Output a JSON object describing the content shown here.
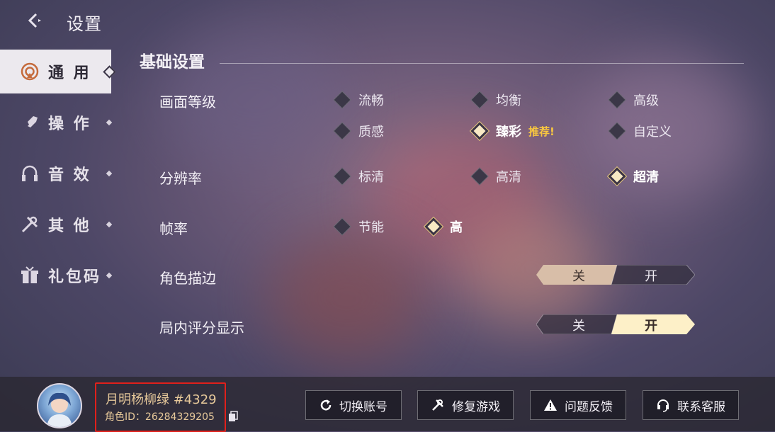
{
  "header": {
    "title": "设置"
  },
  "sidebar": {
    "items": [
      {
        "label": "通 用",
        "icon": "general-icon",
        "active": true
      },
      {
        "label": "操 作",
        "icon": "operation-icon",
        "active": false
      },
      {
        "label": "音 效",
        "icon": "headphones-icon",
        "active": false
      },
      {
        "label": "其 他",
        "icon": "tools-icon",
        "active": false
      },
      {
        "label": "礼包码",
        "icon": "gift-icon",
        "active": false
      }
    ]
  },
  "section": {
    "title": "基础设置"
  },
  "settings": {
    "quality": {
      "label": "画面等级",
      "options": [
        "流畅",
        "均衡",
        "高级",
        "质感",
        "臻彩",
        "自定义"
      ],
      "selected": "臻彩",
      "badge": "推荐!"
    },
    "resolution": {
      "label": "分辨率",
      "options": [
        "标清",
        "高清",
        "超清"
      ],
      "selected": "超清"
    },
    "framerate": {
      "label": "帧率",
      "options": [
        "节能",
        "高"
      ],
      "selected": "高"
    },
    "outline": {
      "label": "角色描边",
      "off": "关",
      "on": "开",
      "value": "关"
    },
    "score_display": {
      "label": "局内评分显示",
      "off": "关",
      "on": "开",
      "value": "开"
    }
  },
  "footer": {
    "player_name": "月明杨柳绿 #4329",
    "player_id": "角色ID：26284329205",
    "buttons": [
      "切换账号",
      "修复游戏",
      "问题反馈",
      "联系客服"
    ]
  },
  "colors": {
    "highlight": "#e0201b",
    "accent_gold": "#f7c640",
    "toggle_active": "#fdf0c8"
  }
}
